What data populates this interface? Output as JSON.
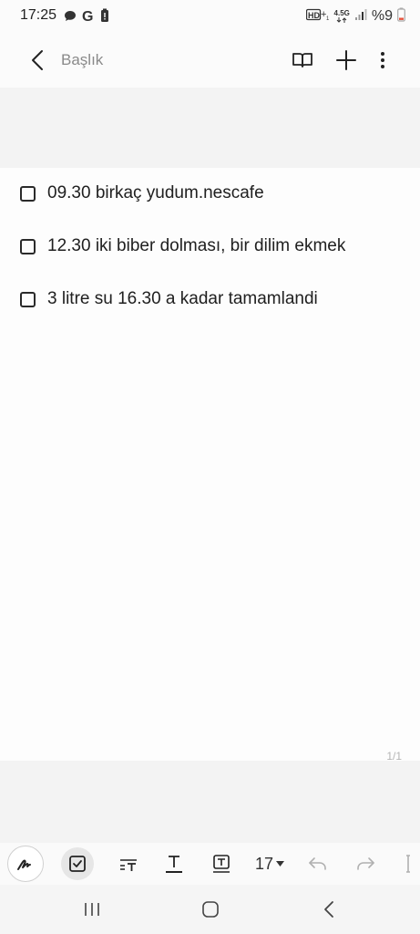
{
  "status_bar": {
    "time": "17:25",
    "network": "4.5G",
    "battery": "%9",
    "icons": [
      "chat-icon",
      "google-icon",
      "battery-alert-icon",
      "hd-voice-icon",
      "signal-icon",
      "battery-icon"
    ]
  },
  "header": {
    "title": "Başlık",
    "back_icon": "chevron-left-icon",
    "actions": [
      "book-icon",
      "plus-icon",
      "more-vertical-icon"
    ]
  },
  "note": {
    "items": [
      {
        "text": "09.30 birkaç yudum.nescafe",
        "checked": false
      },
      {
        "text": "12.30 iki biber dolması, bir dilim ekmek",
        "checked": false
      },
      {
        "text": "3 litre su 16.30 a kadar tamamlandi",
        "checked": false
      }
    ],
    "page_counter": "1/1"
  },
  "toolbar": {
    "font_size": "17",
    "tools": [
      "pen-icon",
      "checkbox-icon",
      "text-style-icon",
      "underline-icon",
      "text-box-icon",
      "undo-icon",
      "redo-icon",
      "more-icon"
    ]
  },
  "navigation": {
    "buttons": [
      "recent-apps-icon",
      "home-icon",
      "back-icon"
    ]
  }
}
